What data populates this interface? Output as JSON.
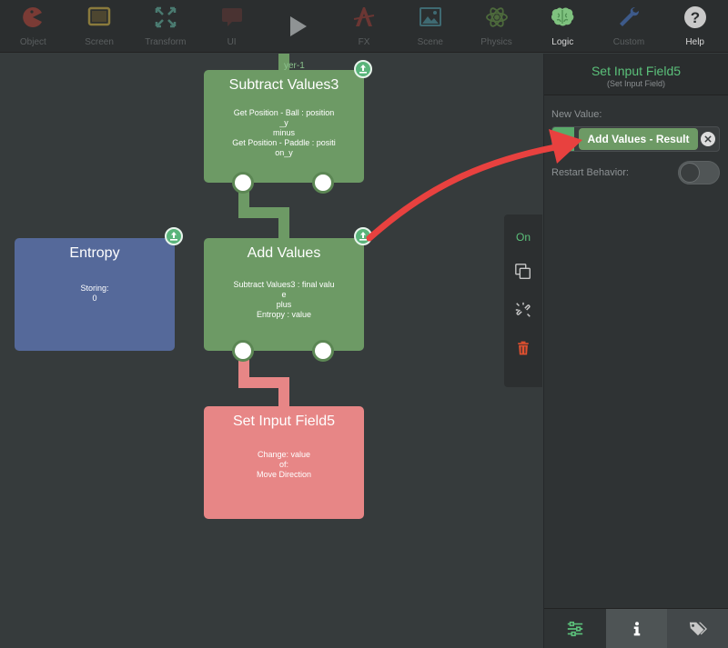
{
  "toolbar": {
    "items": [
      {
        "label": "Object",
        "icon": "pacman-icon"
      },
      {
        "label": "Screen",
        "icon": "screen-icon"
      },
      {
        "label": "Transform",
        "icon": "transform-icon"
      },
      {
        "label": "UI",
        "icon": "ui-chat-icon"
      },
      {
        "label": "",
        "icon": "play-icon"
      },
      {
        "label": "FX",
        "icon": "fx-icon"
      },
      {
        "label": "Scene",
        "icon": "scene-image-icon"
      },
      {
        "label": "Physics",
        "icon": "atom-icon"
      },
      {
        "label": "Logic",
        "icon": "brain-icon"
      },
      {
        "label": "Custom",
        "icon": "wrench-icon"
      },
      {
        "label": "Help",
        "icon": "help-icon"
      }
    ]
  },
  "canvas": {
    "partial_label": "yer-1",
    "nodes": {
      "subtract": {
        "title": "Subtract Values3",
        "lines": [
          "Get Position - Ball : position",
          "_y",
          "minus",
          "Get Position - Paddle : positi",
          "on_y"
        ]
      },
      "add": {
        "title": "Add Values",
        "lines": [
          "Subtract Values3 : final valu",
          "e",
          "plus",
          "Entropy : value"
        ]
      },
      "entropy": {
        "title": "Entropy",
        "lines": [
          "Storing:",
          "0"
        ]
      },
      "setinput": {
        "title": "Set Input Field5",
        "lines": [
          "Change: value",
          "of:",
          "Move Direction"
        ]
      }
    }
  },
  "side_tools": {
    "on_label": "On"
  },
  "panel": {
    "title": "Set Input Field5",
    "subtitle": "(Set Input Field)",
    "new_value_label": "New Value:",
    "new_value": "Add Values - Result",
    "restart_label": "Restart Behavior:",
    "restart_on": false
  },
  "colors": {
    "accent_green": "#5bc07a",
    "node_green": "#6d9a65",
    "node_blue": "#55699a",
    "node_red": "#e78686",
    "arrow_red": "#e8413f"
  }
}
